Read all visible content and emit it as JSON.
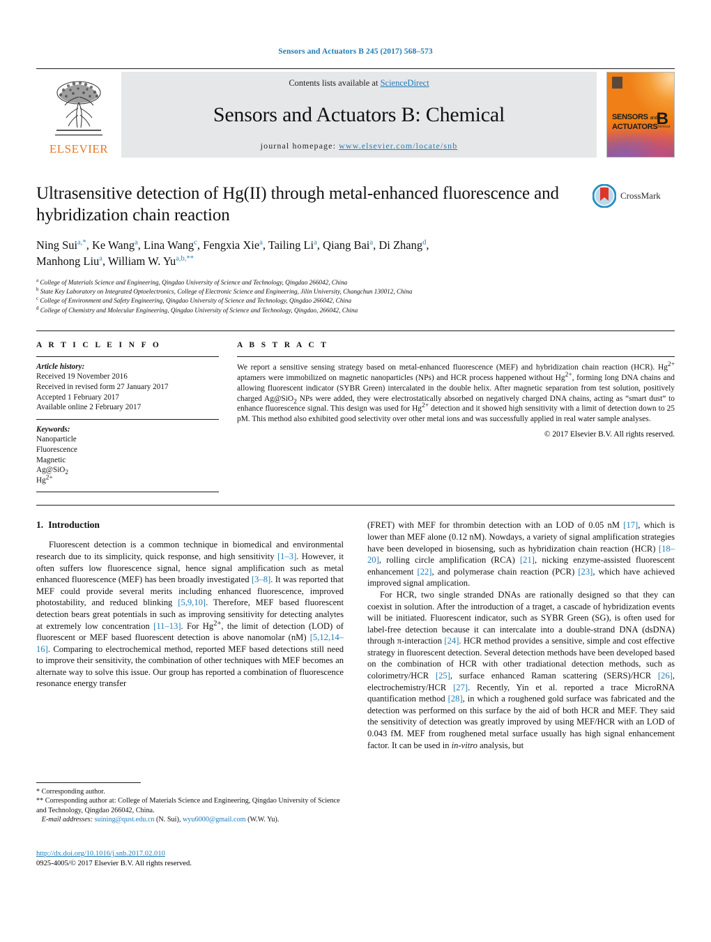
{
  "running_head": "Sensors and Actuators B 245 (2017) 568–573",
  "masthead": {
    "publisher": "ELSEVIER",
    "contents_prefix": "Contents lists available at ",
    "contents_link": "ScienceDirect",
    "journal_title": "Sensors and Actuators B: Chemical",
    "homepage_prefix": "journal homepage: ",
    "homepage_url": "www.elsevier.com/locate/snb",
    "cover": {
      "line1": "SENSORS",
      "and": "and",
      "line2": "ACTUATORS",
      "letter": "B",
      "sub": "Chemical"
    }
  },
  "article": {
    "title": "Ultrasensitive detection of Hg(II) through metal-enhanced fluorescence and hybridization chain reaction",
    "crossmark_label": "CrossMark",
    "authors_line1_html": "Ning Sui<sup>a,*</sup>, Ke Wang<sup>a</sup>, Lina Wang<sup>c</sup>, Fengxia Xie<sup>a</sup>, Tailing Li<sup>a</sup>, Qiang Bai<sup>a</sup>, Di Zhang<sup>d</sup>,",
    "authors_line2_html": "Manhong Liu<sup>a</sup>, William W. Yu<sup>a,b,**</sup>",
    "affiliations": [
      {
        "mark": "a",
        "text": "College of Materials Science and Engineering, Qingdao University of Science and Technology, Qingdao 266042, China"
      },
      {
        "mark": "b",
        "text": "State Key Laboratory on Integrated Optoelectronics, College of Electronic Science and Engineering, Jilin University, Changchun 130012, China"
      },
      {
        "mark": "c",
        "text": "College of Environment and Safety Engineering, Qingdao University of Science and Technology, Qingdao 266042, China"
      },
      {
        "mark": "d",
        "text": "College of Chemistry and Molecular Engineering, Qingdao University of Science and Technology, Qingdao, 266042, China"
      }
    ]
  },
  "article_info": {
    "heading": "A R T I C L E    I N F O",
    "history_label": "Article history:",
    "history": [
      "Received 19 November 2016",
      "Received in revised form 27 January 2017",
      "Accepted 1 February 2017",
      "Available online 2 February 2017"
    ],
    "keywords_label": "Keywords:",
    "keywords": [
      "Nanoparticle",
      "Fluorescence",
      "Magnetic",
      "Ag@SiO2",
      "Hg2+"
    ]
  },
  "abstract": {
    "heading": "A B S T R A C T",
    "body_html": "We report a sensitive sensing strategy based on metal-enhanced fluorescence (MEF) and hybridization chain reaction (HCR). Hg<sup>2+</sup> aptamers were immobilized on magnetic nanoparticles (NPs) and HCR process happened without Hg<sup>2+</sup>, forming long DNA chains and allowing fluorescent indicator (SYBR Green) intercalated in the double helix. After magnetic separation from test solution, positively charged Ag@SiO<sub>2</sub> NPs were added, they were electrostatically absorbed on negatively charged DNA chains, acting as &ldquo;smart dust&rdquo; to enhance fluorescence signal. This design was used for Hg<sup>2+</sup> detection and it showed high sensitivity with a limit of detection down to 25 pM. This method also exhibited good selectivity over other metal ions and was successfully applied in real water sample analyses.",
    "copyright": "© 2017 Elsevier B.V. All rights reserved."
  },
  "sections": {
    "introduction_number": "1.",
    "introduction_title": "Introduction"
  },
  "body": {
    "left_paragraph_html": "Fluorescent detection is a common technique in biomedical and environmental research due to its simplicity, quick response, and high sensitivity <span class=\"ref\">[1–3]</span>. However, it often suffers low fluorescence signal, hence signal amplification such as metal enhanced fluorescence (MEF) has been broadly investigated <span class=\"ref\">[3–8]</span>. It was reported that MEF could provide several merits including enhanced fluorescence, improved photostability, and reduced blinking <span class=\"ref\">[5,9,10]</span>. Therefore, MEF based fluorescent detection bears great potentials in such as improving sensitivity for detecting analytes at extremely low concentration <span class=\"ref\">[11–13]</span>. For Hg<sup>2+</sup>, the limit of detection (LOD) of fluorescent or MEF based fluorescent detection is above nanomolar (nM) <span class=\"ref\">[5,12,14–16]</span>. Comparing to electrochemical method, reported MEF based detections still need to improve their sensitivity, the combination of other techniques with MEF becomes an alternate way to solve this issue. Our group has reported a combination of fluorescence resonance energy transfer",
    "right_paragraph1_html": "(FRET) with MEF for thrombin detection with an LOD of 0.05 nM <span class=\"ref\">[17]</span>, which is lower than MEF alone (0.12 nM). Nowdays, a variety of signal amplification strategies have been developed in biosensing, such as hybridization chain reaction (HCR) <span class=\"ref\">[18–20]</span>, rolling circle amplification (RCA) <span class=\"ref\">[21]</span>, nicking enzyme-assisted fluorescent enhancement <span class=\"ref\">[22]</span>, and polymerase chain reaction (PCR) <span class=\"ref\">[23]</span>, which have achieved improved signal amplication.",
    "right_paragraph2_html": "For HCR, two single stranded DNAs are rationally designed so that they can coexist in solution. After the introduction of a traget, a cascade of hybridization events will be initiated. Fluorescent indicator, such as SYBR Green (SG), is often used for label-free detection because it can intercalate into a double-strand DNA (dsDNA) through &pi;-interaction <span class=\"ref\">[24]</span>. HCR method provides a sensitive, simple and cost effective strategy in fluorescent detection. Several detection methods have been developed based on the combination of HCR with other tradiational detection methods, such as colorimetry/HCR <span class=\"ref\">[25]</span>, surface enhanced Raman scattering (SERS)/HCR <span class=\"ref\">[26]</span>, electrochemistry/HCR <span class=\"ref\">[27]</span>. Recently, Yin et al. reported a trace MicroRNA quantification method <span class=\"ref\">[28]</span>, in which a roughened gold surface was fabricated and the detection was performed on this surface by the aid of both HCR and MEF. They said the sensitivity of detection was greatly improved by using MEF/HCR with an LOD of 0.043 fM. MEF from roughened metal surface usually has high signal enhancement factor. It can be used in <i>in-vitro</i> analysis, but"
  },
  "footnotes": {
    "line1": "*  Corresponding author.",
    "line2": "**  Corresponding author at: College of Materials Science and Engineering, Qingdao University of Science and Technology, Qingdao 266042, China.",
    "email_label": "E-mail addresses:",
    "email1": "suining@qust.edu.cn",
    "email1_owner": "(N. Sui),",
    "email2": "wyu6000@gmail.com",
    "email2_owner": "(W.W. Yu)."
  },
  "doi": {
    "url": "http://dx.doi.org/10.1016/j.snb.2017.02.010",
    "issn_line": "0925-4005/© 2017 Elsevier B.V. All rights reserved."
  },
  "colors": {
    "link": "#1f7bb6",
    "elsevier_orange": "#e87722",
    "masthead_gray": "#e6e7e8"
  }
}
